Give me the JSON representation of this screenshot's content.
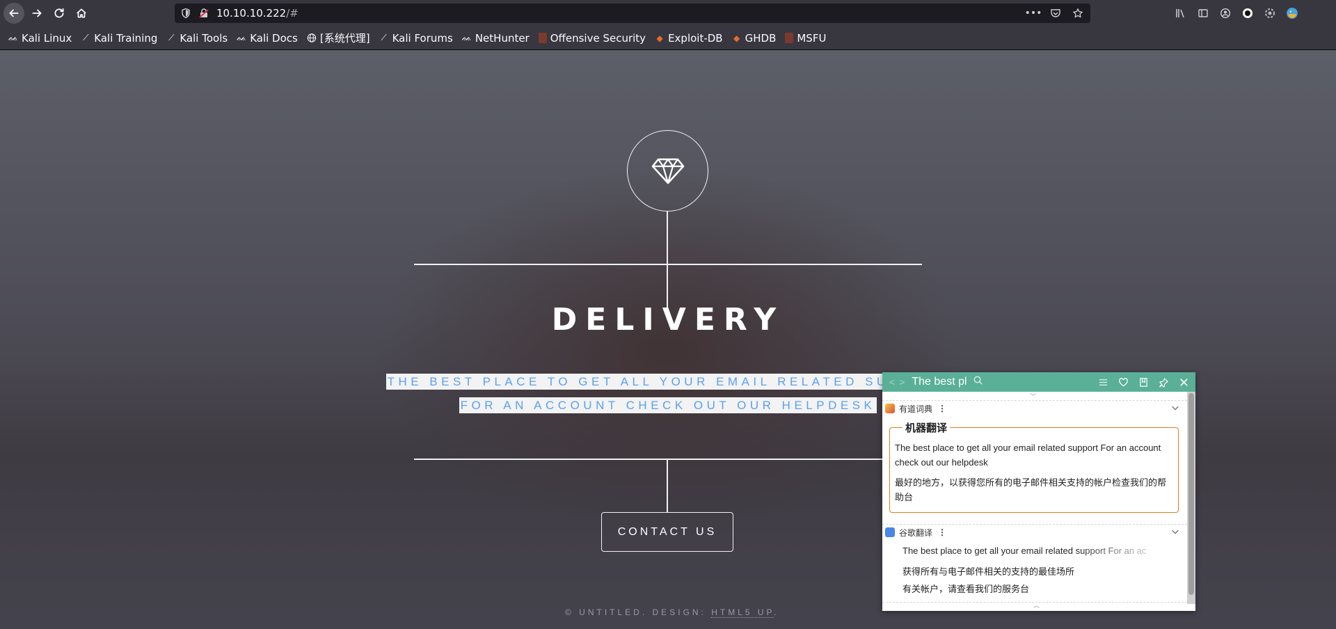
{
  "browser": {
    "url_host": "10.10.10.222",
    "url_path": "/#",
    "bookmarks": [
      {
        "label": "Kali Linux",
        "icon": "kali-dragon-icon"
      },
      {
        "label": "Kali Training",
        "icon": "kali-training-icon"
      },
      {
        "label": "Kali Tools",
        "icon": "kali-tools-icon"
      },
      {
        "label": "Kali Docs",
        "icon": "kali-docs-icon"
      },
      {
        "label": "[系统代理]",
        "icon": "globe-icon"
      },
      {
        "label": "Kali Forums",
        "icon": "kali-forums-icon"
      },
      {
        "label": "NetHunter",
        "icon": "nethunter-icon"
      },
      {
        "label": "Offensive Security",
        "icon": "offsec-icon"
      },
      {
        "label": "Exploit-DB",
        "icon": "exploitdb-icon"
      },
      {
        "label": "GHDB",
        "icon": "ghdb-icon"
      },
      {
        "label": "MSFU",
        "icon": "msfu-icon"
      }
    ],
    "colors": {
      "chrome": "#38373f",
      "urlbar": "#1c1b22"
    }
  },
  "page": {
    "title": "DELIVERY",
    "tagline_line1": "THE BEST PLACE TO GET ALL YOUR EMAIL RELATED SUPPORT",
    "tagline_line2": "FOR AN ACCOUNT CHECK OUT OUR HELPDESK",
    "contact_label": "CONTACT US",
    "footer_prefix": "© UNTITLED. DESIGN: ",
    "footer_link": "HTML5 UP",
    "footer_suffix": ".",
    "icon": "diamond-icon"
  },
  "popup": {
    "query": "The best pl",
    "youdao_label": "有道词典",
    "machine_translation_title": "机器翻译",
    "mt_source": "The best place to get all your email related support For an account check out our helpdesk",
    "mt_result": "最好的地方，以获得您所有的电子邮件相关支持的帐户检查我们的帮助台",
    "google_label": "谷歌翻译",
    "google_source": "The best place to get all your email related support For an ac",
    "google_result_1": "获得所有与电子邮件相关的支持的最佳场所",
    "google_result_2": "有关帐户，请查看我们的服务台",
    "accent_color": "#5aaf97",
    "box_color": "#e07b1c"
  }
}
